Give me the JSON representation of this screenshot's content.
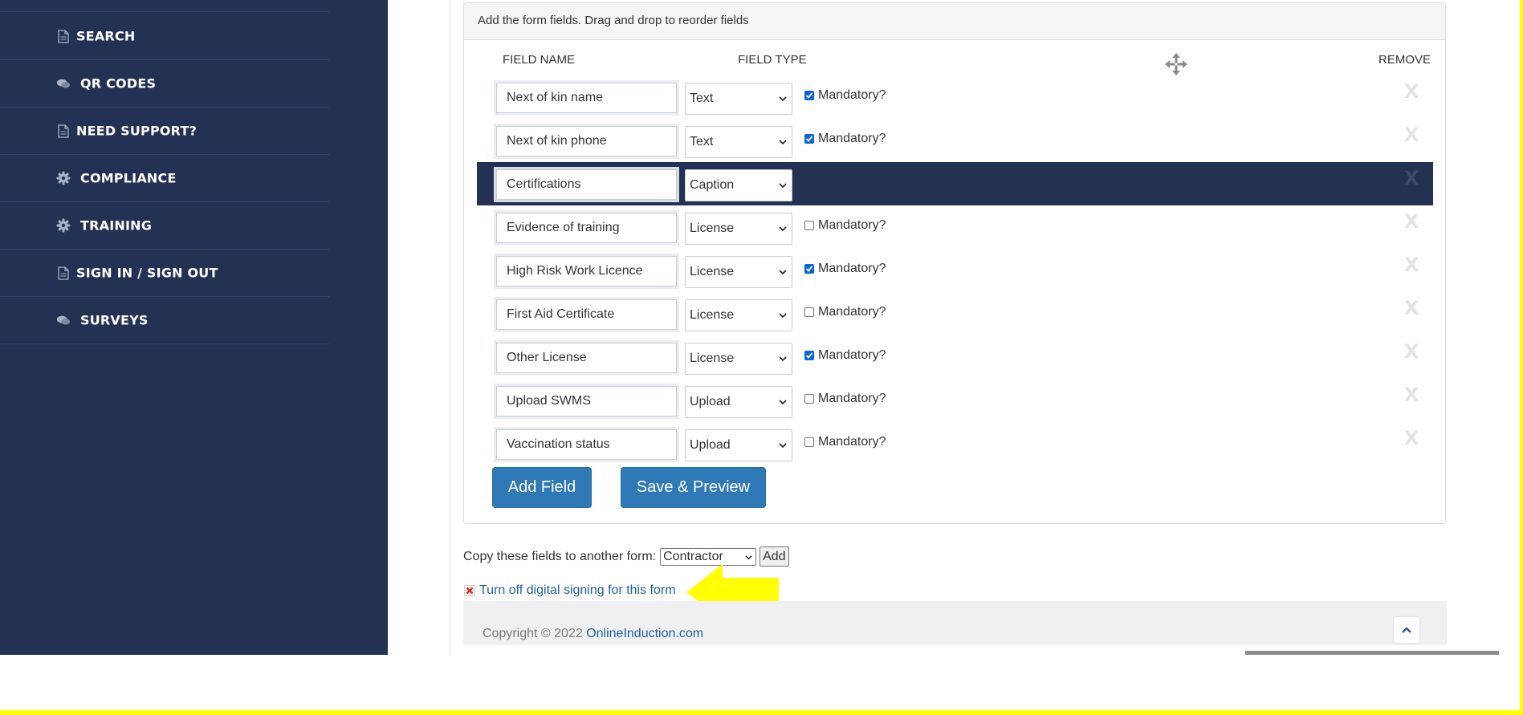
{
  "sidebar": {
    "items": [
      {
        "label": "SEARCH",
        "icon": "document-icon"
      },
      {
        "label": "QR CODES",
        "icon": "chat-icon"
      },
      {
        "label": "NEED SUPPORT?",
        "icon": "document-icon"
      },
      {
        "label": "COMPLIANCE",
        "icon": "gear-icon"
      },
      {
        "label": "TRAINING",
        "icon": "gear-icon"
      },
      {
        "label": "SIGN IN / SIGN OUT",
        "icon": "document-icon"
      },
      {
        "label": "SURVEYS",
        "icon": "chat-icon"
      }
    ]
  },
  "panel": {
    "heading": "Add the form fields. Drag and drop to reorder fields",
    "columns": {
      "field_name": "FIELD NAME",
      "field_type": "FIELD TYPE",
      "remove": "REMOVE"
    },
    "rows": [
      {
        "name": "Next of kin name",
        "type": "Text",
        "mandatory": true,
        "mandatory_label": "Mandatory?",
        "remove": "X"
      },
      {
        "name": "Next of kin phone",
        "type": "Text",
        "mandatory": true,
        "mandatory_label": "Mandatory?",
        "remove": "X"
      },
      {
        "name": "Certifications",
        "type": "Caption",
        "remove": "X"
      },
      {
        "name": "Evidence of training",
        "type": "License",
        "mandatory": false,
        "mandatory_label": "Mandatory?",
        "remove": "X"
      },
      {
        "name": "High Risk Work Licence",
        "type": "License",
        "mandatory": true,
        "mandatory_label": "Mandatory?",
        "remove": "X"
      },
      {
        "name": "First Aid Certificate",
        "type": "License",
        "mandatory": false,
        "mandatory_label": "Mandatory?",
        "remove": "X"
      },
      {
        "name": "Other License",
        "type": "License",
        "mandatory": true,
        "mandatory_label": "Mandatory?",
        "remove": "X"
      },
      {
        "name": "Upload SWMS",
        "type": "Upload",
        "mandatory": false,
        "mandatory_label": "Mandatory?",
        "remove": "X"
      },
      {
        "name": "Vaccination status",
        "type": "Upload",
        "mandatory": false,
        "mandatory_label": "Mandatory?",
        "remove": "X"
      }
    ],
    "add_field_label": "Add Field",
    "save_preview_label": "Save & Preview"
  },
  "copy": {
    "label": "Copy these fields to another form:",
    "selected": "Contractor",
    "add_label": "Add"
  },
  "digital_signing_link": "Turn off digital signing for this form",
  "footer": {
    "copyright": "Copyright © 2022 ",
    "site_link": "OnlineInduction.com"
  },
  "colors": {
    "sidebar_bg": "#233152",
    "primary_button": "#2f79b6",
    "highlight_arrow": "#ffff00",
    "link": "#1f5f9e"
  }
}
